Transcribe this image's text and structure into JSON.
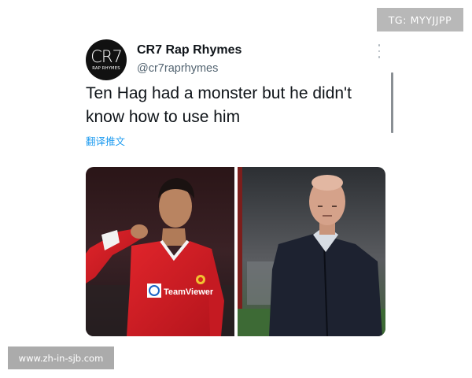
{
  "overlay": {
    "tg_badge": "TG: MYYJJPP",
    "watermark": "www.zh-in-sjb.com"
  },
  "tweet": {
    "avatar": {
      "monogram": "CR7",
      "subtitle": "RAP RHYMES"
    },
    "display_name": "CR7 Rap Rhymes",
    "handle": "@cr7raprhymes",
    "text": "Ten Hag had a monster but he didn't know how to use him",
    "translate_label": "翻译推文",
    "more_icon": "more-vertical-icon",
    "colors": {
      "link": "#1d9bf0",
      "name": "#0f1419",
      "handle": "#536471"
    }
  },
  "media": {
    "left_photo": {
      "shirt_text": "TeamViewer",
      "subject": "footballer-celebrating"
    },
    "right_photo": {
      "subject": "manager-on-touchline"
    }
  }
}
